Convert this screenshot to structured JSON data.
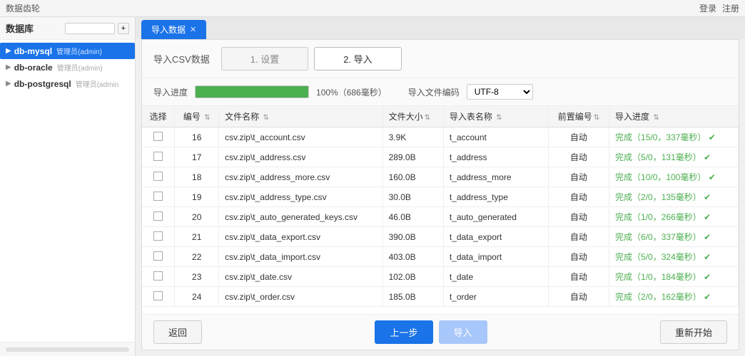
{
  "app": {
    "title": "数据齿轮",
    "login": "登录",
    "register": "注册"
  },
  "sidebar": {
    "title": "数据库",
    "search_placeholder": "",
    "add_btn": "+",
    "items": [
      {
        "id": "db-mysql",
        "name": "db-mysql",
        "role": "管理员(admin)",
        "active": true,
        "indent": 0
      },
      {
        "id": "db-oracle",
        "name": "db-oracle",
        "role": "管理员(admin)",
        "active": false,
        "indent": 0
      },
      {
        "id": "db-postgresql",
        "name": "db-postgresql",
        "role": "管理员(admin",
        "active": false,
        "indent": 0
      }
    ]
  },
  "tab": {
    "label": "导入数据",
    "close": "✕"
  },
  "import": {
    "label": "导入CSV数据",
    "step1": "1. 设置",
    "step2": "2. 导入",
    "progress_label": "导入进度",
    "progress_percent": "100%（686毫秒）",
    "encoding_label": "导入文件编码",
    "encoding_value": "UTF-8"
  },
  "table": {
    "columns": [
      "选择",
      "编号",
      "文件名称",
      "文件大小",
      "导入表名称",
      "前置编号",
      "导入进度"
    ],
    "rows": [
      {
        "check": false,
        "id": "16",
        "filename": "csv.zip\\t_account.csv",
        "size": "3.9K",
        "table_name": "t_account",
        "prefix": "自动",
        "progress": "完成（15/0，337毫秒）"
      },
      {
        "check": false,
        "id": "17",
        "filename": "csv.zip\\t_address.csv",
        "size": "289.0B",
        "table_name": "t_address",
        "prefix": "自动",
        "progress": "完成（5/0，131毫秒）"
      },
      {
        "check": false,
        "id": "18",
        "filename": "csv.zip\\t_address_more.csv",
        "size": "160.0B",
        "table_name": "t_address_more",
        "prefix": "自动",
        "progress": "完成（10/0，100毫秒）"
      },
      {
        "check": false,
        "id": "19",
        "filename": "csv.zip\\t_address_type.csv",
        "size": "30.0B",
        "table_name": "t_address_type",
        "prefix": "自动",
        "progress": "完成（2/0，135毫秒）"
      },
      {
        "check": false,
        "id": "20",
        "filename": "csv.zip\\t_auto_generated_keys.csv",
        "size": "46.0B",
        "table_name": "t_auto_generated",
        "prefix": "自动",
        "progress": "完成（1/0，266毫秒）"
      },
      {
        "check": false,
        "id": "21",
        "filename": "csv.zip\\t_data_export.csv",
        "size": "390.0B",
        "table_name": "t_data_export",
        "prefix": "自动",
        "progress": "完成（6/0，337毫秒）"
      },
      {
        "check": false,
        "id": "22",
        "filename": "csv.zip\\t_data_import.csv",
        "size": "403.0B",
        "table_name": "t_data_import",
        "prefix": "自动",
        "progress": "完成（5/0，324毫秒）"
      },
      {
        "check": false,
        "id": "23",
        "filename": "csv.zip\\t_date.csv",
        "size": "102.0B",
        "table_name": "t_date",
        "prefix": "自动",
        "progress": "完成（1/0，184毫秒）"
      },
      {
        "check": false,
        "id": "24",
        "filename": "csv.zip\\t_order.csv",
        "size": "185.0B",
        "table_name": "t_order",
        "prefix": "自动",
        "progress": "完成（2/0，162毫秒）"
      }
    ]
  },
  "footer": {
    "back_btn": "返回",
    "prev_btn": "上一步",
    "import_btn": "导入",
    "restart_btn": "重新开始"
  }
}
